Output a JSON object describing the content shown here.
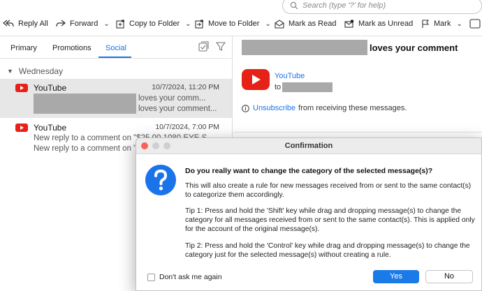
{
  "search": {
    "placeholder": "Search (type '?' for help)"
  },
  "toolbar": {
    "reply_all": "Reply All",
    "forward": "Forward",
    "copy_to_folder": "Copy to Folder",
    "move_to_folder": "Move to Folder",
    "mark_as_read": "Mark as Read",
    "mark_as_unread": "Mark as Unread",
    "mark": "Mark"
  },
  "tabs": [
    {
      "label": "Primary"
    },
    {
      "label": "Promotions"
    },
    {
      "label": "Social",
      "active": true
    }
  ],
  "group": {
    "label": "Wednesday"
  },
  "messages": [
    {
      "sender": "YouTube",
      "date": "10/7/2024, 11:20 PM",
      "line1": "loves your comm...",
      "line2": "loves your comment...",
      "selected": true
    },
    {
      "sender": "YouTube",
      "date": "10/7/2024, 7:00 PM",
      "line1": "New reply to a comment on \"$25.00 1080 EYE S",
      "line2": "New reply to a comment on \"$"
    }
  ],
  "reader": {
    "subject": "loves your comment",
    "from_name": "YouTube",
    "to_label": "to",
    "unsubscribe_link": "Unsubscribe",
    "unsubscribe_text": "from receiving these messages."
  },
  "dialog": {
    "title": "Confirmation",
    "question": "Do you really want to change the category of the selected message(s)?",
    "para1": "This will also create a rule for new messages received from or sent to the same contact(s) to categorize them accordingly.",
    "para2": "Tip 1: Press and hold the 'Shift' key while drag and dropping message(s) to change the category for all messages received from or sent to the same contact(s). This is applied only for the account of the original message(s).",
    "para3": "Tip 2: Press and hold the 'Control' key while drag and dropping message(s) to change the category just for the selected message(s) without creating a rule.",
    "dont_ask": "Don't ask me again",
    "yes": "Yes",
    "no": "No"
  },
  "colors": {
    "accent": "#1a73e8",
    "youtube_red": "#e62117",
    "yes_button": "#1a7ae8"
  }
}
